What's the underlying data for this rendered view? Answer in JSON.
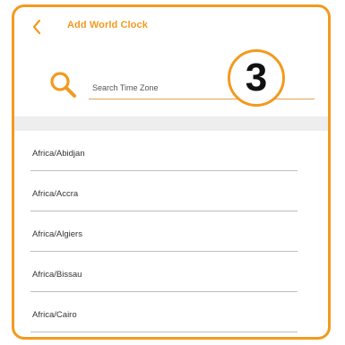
{
  "header": {
    "title": "Add World Clock",
    "back_icon": "chevron-left-icon"
  },
  "search": {
    "placeholder": "Search Time Zone",
    "value": "",
    "icon": "search-icon"
  },
  "badge": {
    "number": "3"
  },
  "timezones": [
    "Africa/Abidjan",
    "Africa/Accra",
    "Africa/Algiers",
    "Africa/Bissau",
    "Africa/Cairo"
  ],
  "colors": {
    "accent": "#F29A1F",
    "divider_band": "#EEEEEE",
    "separator": "#BDBDBD"
  }
}
